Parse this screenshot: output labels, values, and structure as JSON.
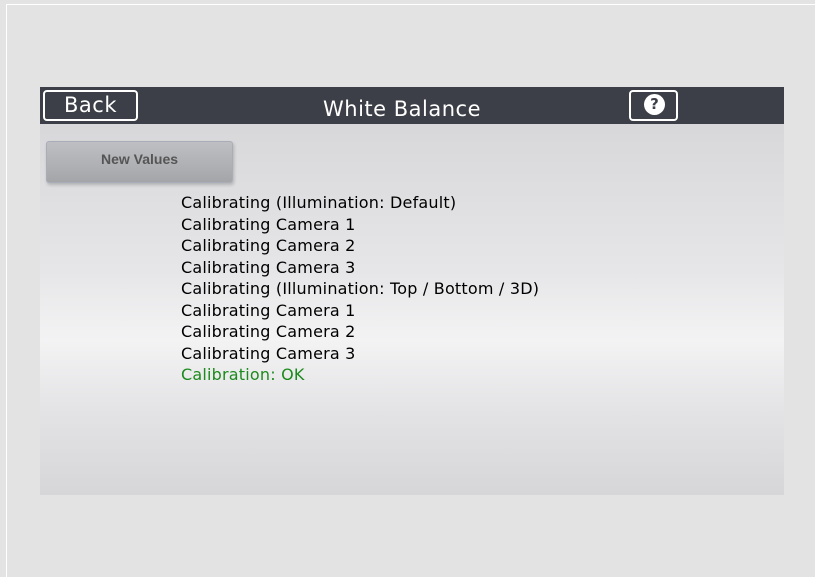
{
  "header": {
    "back_label": "Back",
    "title": "White Balance",
    "help_label": "?"
  },
  "actions": {
    "new_values_label": "New Values"
  },
  "log": {
    "lines": [
      "Calibrating (Illumination: Default)",
      "Calibrating Camera 1",
      "Calibrating Camera 2",
      "Calibrating Camera 3",
      "Calibrating (Illumination: Top / Bottom / 3D)",
      "Calibrating Camera 1",
      "Calibrating Camera 2",
      "Calibrating Camera 3"
    ],
    "result": "Calibration: OK"
  },
  "colors": {
    "titlebar": "#3c3f47",
    "result_text": "#1c8a1c"
  }
}
